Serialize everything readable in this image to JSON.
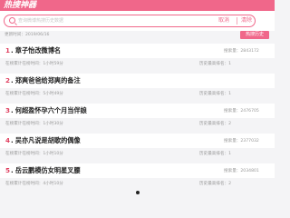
{
  "header": {
    "brand": "热搜神器"
  },
  "search": {
    "placeholder": "查询微博热搜历史数据",
    "cancel_label": "取消",
    "clear_label": "清除"
  },
  "toolbar": {
    "update_time": "更新时间：2019/06/16",
    "history_label": "热搜历史"
  },
  "items": [
    {
      "rank": "1",
      "title": "章子怡改微博名",
      "search_count": "搜索量：2843172",
      "duration": "在榜累计在榜时间：1小时59分",
      "peak": "历史最高排名：1"
    },
    {
      "rank": "2",
      "title": "郑爽爸爸给郑爽的备注",
      "search_count": "",
      "duration": "在榜累计在榜时间：5小时49分",
      "peak": "历史最高排名：1"
    },
    {
      "rank": "3",
      "title": "何超盈怀孕六个月当伴娘",
      "search_count": "搜索量：2476705",
      "duration": "在榜累计在榜时间：1小时30分",
      "peak": "历史最高排名：2"
    },
    {
      "rank": "4",
      "title": "吴亦凡说是胡歌的偶像",
      "search_count": "搜索量：2377032",
      "duration": "在榜累计在榜时间：1小时10分",
      "peak": "历史最高排名：1"
    },
    {
      "rank": "5",
      "title": "岳云鹏模仿女明星叉腰",
      "search_count": "搜索量：2034801",
      "duration": "在榜累计在榜时间：4小时10分",
      "peak": "历史最高排名：2"
    }
  ],
  "colors": {
    "accent": "#f0678a",
    "rank": "#e04060"
  }
}
